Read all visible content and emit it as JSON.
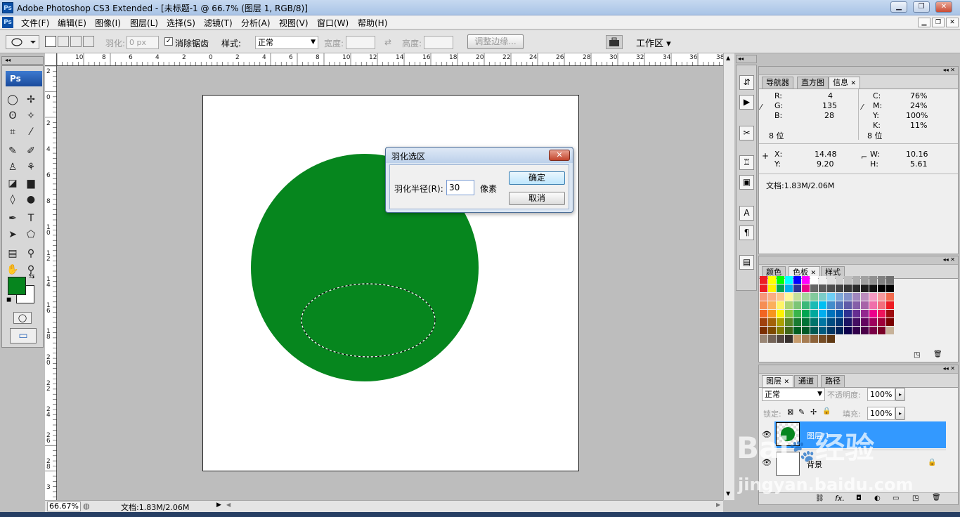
{
  "window": {
    "title": "Adobe Photoshop CS3 Extended - [未标题-1 @ 66.7% (图层 1, RGB/8)]",
    "app_icon": "Ps",
    "controls": [
      "▁",
      "❐",
      "✕"
    ]
  },
  "menu": {
    "items": [
      "文件(F)",
      "编辑(E)",
      "图像(I)",
      "图层(L)",
      "选择(S)",
      "滤镜(T)",
      "分析(A)",
      "视图(V)",
      "窗口(W)",
      "帮助(H)"
    ],
    "mdi": [
      "▁",
      "❐",
      "✕"
    ]
  },
  "options": {
    "feather_label": "羽化:",
    "feather_value": "0 px",
    "antialias_label": "消除锯齿",
    "antialias_check": "✓",
    "style_label": "样式:",
    "style_value": "正常",
    "width_label": "宽度:",
    "height_label": "高度:",
    "swap_icon": "⇄",
    "refine_label": "调整边缘...",
    "workspace_label": "工作区 ▾"
  },
  "rulers": {
    "top": [
      "10",
      "8",
      "6",
      "4",
      "2",
      "0",
      "2",
      "4",
      "6",
      "8",
      "10",
      "12",
      "14",
      "16",
      "18",
      "20",
      "22",
      "24",
      "26",
      "28",
      "30",
      "32",
      "34",
      "36",
      "38"
    ],
    "left": [
      "2",
      "0",
      "2",
      "4",
      "6",
      "8",
      "1 0",
      "1 2",
      "1 4",
      "1 6",
      "1 8",
      "2 0",
      "2 2",
      "2 4",
      "2 6",
      "2 8",
      "3"
    ]
  },
  "toolbox": {
    "logo": "Ps",
    "tools": [
      [
        "◯",
        "✢"
      ],
      [
        "ʘ",
        "✧"
      ],
      [
        "⌗",
        "⁄"
      ],
      [
        "✎",
        "✐"
      ],
      [
        "♙",
        "⚘"
      ],
      [
        "◪",
        "▆"
      ],
      [
        "◊",
        "●"
      ],
      [
        "✒",
        "T"
      ],
      [
        "➤",
        "⬠"
      ],
      [
        "▤",
        "⚲"
      ],
      [
        "✋",
        "⚲"
      ]
    ],
    "fg_color": "#06851e",
    "bg_color": "#ffffff",
    "quickmask": "◯",
    "screen": "▭",
    "swap": "⇆",
    "default": "◼"
  },
  "canvas": {
    "circle_color": "#06861e"
  },
  "dialog": {
    "title": "羽化选区",
    "close": "✕",
    "radius_label": "羽化半径(R):",
    "radius_value": "30",
    "unit": "像素",
    "ok": "确定",
    "cancel": "取消"
  },
  "dock": {
    "icons": [
      "⇵",
      "▶",
      "✂",
      "♖",
      "▣",
      "A",
      "¶",
      "▤"
    ]
  },
  "info_panel": {
    "tabs": [
      "导航器",
      "直方图",
      "信息"
    ],
    "close": "✕",
    "R_label": "R:",
    "R": "4",
    "G_label": "G:",
    "G": "135",
    "B_label": "B:",
    "B": "28",
    "C_label": "C:",
    "C": "76%",
    "M_label": "M:",
    "M": "24%",
    "Y_label": "Y:",
    "Y": "100%",
    "K_label": "K:",
    "K": "11%",
    "bits_left": "8 位",
    "bits_right": "8 位",
    "X_label": "X:",
    "X": "14.48",
    "Yc_label": "Y:",
    "Yc": "9.20",
    "W_label": "W:",
    "W": "10.16",
    "H_label": "H:",
    "H": "5.61",
    "doc": "文档:1.83M/2.06M"
  },
  "swatch_panel": {
    "tabs": [
      "颜色",
      "色板",
      "样式"
    ],
    "close": "✕",
    "colors": [
      "#ed1c24",
      "#ffff00",
      "#00ff00",
      "#00ffff",
      "#0000ff",
      "#ff00ff",
      "#ffffff",
      "#f0f0f0",
      "#e0e0e0",
      "#d0d0d0",
      "#c0c0c0",
      "#b0b0b0",
      "#a0a0a0",
      "#909090",
      "#808080",
      "#707070",
      "#ed1c24",
      "#fff200",
      "#00a651",
      "#00aeef",
      "#2e3192",
      "#ec008c",
      "#666666",
      "#5a5a5a",
      "#4e4e4e",
      "#424242",
      "#363636",
      "#2a2a2a",
      "#1e1e1e",
      "#121212",
      "#000000",
      "#000000",
      "#f7977a",
      "#fbad82",
      "#fdc68a",
      "#fff79a",
      "#c4df9b",
      "#a3d39c",
      "#82ca9d",
      "#7bcdc8",
      "#6ecff6",
      "#7ea7d8",
      "#8493ca",
      "#a187be",
      "#bc8dbf",
      "#f49ac2",
      "#f6989d",
      "#f26c4f",
      "#f68e55",
      "#fbaf5c",
      "#fff467",
      "#acd372",
      "#7cc576",
      "#3bb878",
      "#1abbb4",
      "#00bff3",
      "#438ccb",
      "#5574b9",
      "#605ca8",
      "#855fa8",
      "#a763a8",
      "#f06eaa",
      "#f26d7d",
      "#ed1c24",
      "#f26522",
      "#f7941d",
      "#fff200",
      "#8dc73f",
      "#39b54a",
      "#00a651",
      "#00a99d",
      "#00aeef",
      "#0072bc",
      "#0054a6",
      "#2e3192",
      "#662d91",
      "#92278f",
      "#ec008c",
      "#ed145b",
      "#9e0b0f",
      "#a0410d",
      "#a36209",
      "#aba000",
      "#598527",
      "#197b30",
      "#007236",
      "#00746b",
      "#0076a3",
      "#004b80",
      "#003471",
      "#1b1464",
      "#440e62",
      "#630460",
      "#9e005d",
      "#9e0039",
      "#790000",
      "#7b2e00",
      "#7d4900",
      "#827b00",
      "#406618",
      "#005e20",
      "#005826",
      "#005952",
      "#005b7f",
      "#003663",
      "#002157",
      "#0d004c",
      "#32004b",
      "#4b0049",
      "#7b0046",
      "#7a0026",
      "#c7b299",
      "#998675",
      "#736357",
      "#534741",
      "#37302d",
      "#c69c6d",
      "#a67c52",
      "#8c6239",
      "#754c24",
      "#603913"
    ]
  },
  "layers_panel": {
    "tabs": [
      "图层",
      "通道",
      "路径"
    ],
    "close": "✕",
    "blend": "正常",
    "opacity_label": "不透明度:",
    "opacity": "100%",
    "lock_label": "锁定:",
    "fill_label": "填充:",
    "fill": "100%",
    "layers": [
      {
        "name": "图层 1",
        "selected": true
      },
      {
        "name": "背景",
        "selected": false
      }
    ],
    "lock_icons": [
      "⊠",
      "✎",
      "✢",
      "🔒"
    ],
    "bottom_icons": [
      "⛓",
      "fx.",
      "◘",
      "◐",
      "▭",
      "◳",
      "🗑"
    ]
  },
  "status": {
    "zoom": "66.67%",
    "doc": "文档:1.83M/2.06M"
  },
  "watermark": {
    "text1": "Bai",
    "text2": "经验",
    "url": "jingyan.baidu.com"
  }
}
